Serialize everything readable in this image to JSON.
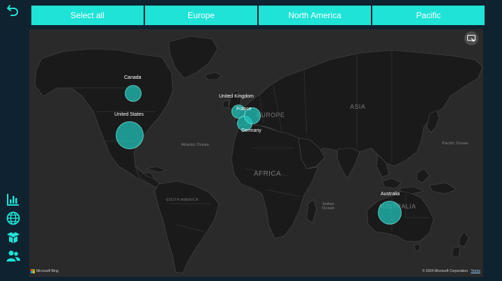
{
  "navigation": {
    "back_icon": "undo-arrow-icon",
    "items": [
      {
        "icon": "bar-chart-icon"
      },
      {
        "icon": "globe-icon"
      },
      {
        "icon": "box-icon"
      },
      {
        "icon": "users-icon"
      }
    ],
    "icon_color": "#1fe3d6"
  },
  "region_filter": {
    "options": [
      "Select all",
      "Europe",
      "North America",
      "Pacific"
    ],
    "color": "#1fe3d6"
  },
  "map": {
    "background_color": "#2a2a2a",
    "land_color": "#1a1a1a",
    "bubble_color": "#1fc8be",
    "ocean_labels": {
      "atlantic": "Atlantic Ocean",
      "pacific": "Pacific Ocean",
      "indian": "Indian\nOcean"
    },
    "region_labels": {
      "europe": "EUROPE",
      "asia": "ASIA",
      "africa": "AFRICA",
      "south_america": "SOUTH AMERICA",
      "australia": "AUSTRALIA"
    },
    "countries": [
      {
        "name": "Canada"
      },
      {
        "name": "United States"
      },
      {
        "name": "United Kingdom"
      },
      {
        "name": "France"
      },
      {
        "name": "Germany"
      },
      {
        "name": "Australia"
      }
    ],
    "focus_mode_icon": "focus-mode-icon",
    "attribution": {
      "brand": "Microsoft Bing",
      "copyright": "© 2024 Microsoft Corporation",
      "terms": "Terms"
    }
  }
}
